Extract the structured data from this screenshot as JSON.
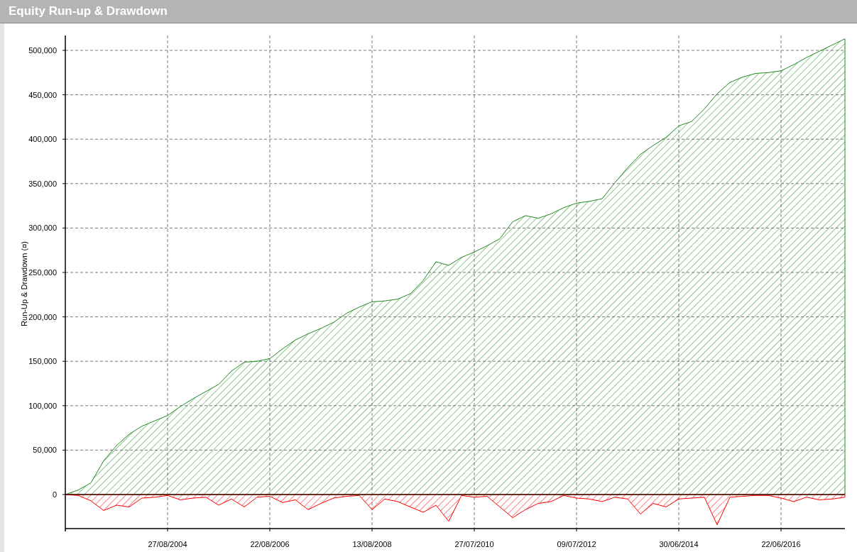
{
  "panel": {
    "title": "Equity Run-up & Drawdown"
  },
  "chart": {
    "chart_data": {
      "type": "area",
      "grid": true,
      "ylabel": "Run-Up & Drawdown (¤)",
      "ylim": [
        -38340,
        516770
      ],
      "yticks": [
        {
          "value": 0,
          "label": "0"
        },
        {
          "value": 50000,
          "label": "50,000"
        },
        {
          "value": 100000,
          "label": "100,000"
        },
        {
          "value": 150000,
          "label": "150,000"
        },
        {
          "value": 200000,
          "label": "200,000"
        },
        {
          "value": 250000,
          "label": "250,000"
        },
        {
          "value": 300000,
          "label": "300,000"
        },
        {
          "value": 350000,
          "label": "350,000"
        },
        {
          "value": 400000,
          "label": "400,000"
        },
        {
          "value": 450000,
          "label": "450,000"
        },
        {
          "value": 500000,
          "label": "500,000"
        }
      ],
      "categories": [
        null,
        null,
        null,
        null,
        null,
        null,
        null,
        null,
        "27/08/2004",
        null,
        null,
        null,
        null,
        null,
        null,
        null,
        "22/08/2006",
        null,
        null,
        null,
        null,
        null,
        null,
        null,
        "13/08/2008",
        null,
        null,
        null,
        null,
        null,
        null,
        null,
        "27/07/2010",
        null,
        null,
        null,
        null,
        null,
        null,
        null,
        "09/07/2012",
        null,
        null,
        null,
        null,
        null,
        null,
        null,
        "30/06/2014",
        null,
        null,
        null,
        null,
        null,
        null,
        null,
        "22/06/2016",
        null,
        null,
        null,
        null,
        null
      ],
      "series": [
        {
          "color": "#228b22",
          "values": [
            0,
            5000,
            13000,
            38000,
            55000,
            68000,
            77000,
            83000,
            89000,
            99000,
            108000,
            116000,
            124000,
            139000,
            149000,
            150000,
            153000,
            164000,
            174000,
            181000,
            187000,
            194000,
            204000,
            211000,
            217000,
            218000,
            220000,
            226000,
            241000,
            262000,
            258000,
            267000,
            273000,
            280000,
            288000,
            307000,
            314000,
            311000,
            316000,
            323000,
            328000,
            330000,
            333000,
            351000,
            368000,
            383000,
            393000,
            402000,
            415000,
            420000,
            434000,
            451000,
            464000,
            470000,
            474000,
            475000,
            477000,
            484000,
            492000,
            499000,
            506000,
            513000
          ]
        },
        {
          "color": "#ff0000",
          "values": [
            0,
            -1000,
            -7000,
            -18000,
            -12000,
            -14000,
            -4000,
            -3000,
            -1000,
            -6000,
            -4000,
            -3000,
            -12000,
            -5000,
            -14000,
            -3000,
            -2000,
            -9000,
            -6000,
            -17000,
            -10000,
            -4000,
            -2000,
            -1000,
            -17000,
            -5000,
            -8000,
            -14000,
            -20000,
            -12000,
            -30000,
            -1000,
            -3000,
            -2000,
            -14000,
            -26000,
            -17000,
            -10000,
            -8000,
            -1000,
            -4000,
            -5000,
            -8000,
            -3000,
            -5000,
            -22000,
            -10000,
            -14000,
            -5000,
            -4000,
            -3000,
            -34000,
            -3000,
            -2000,
            -1000,
            -1000,
            -4000,
            -8000,
            -3000,
            -6000,
            -5000,
            -3000
          ]
        }
      ]
    }
  }
}
